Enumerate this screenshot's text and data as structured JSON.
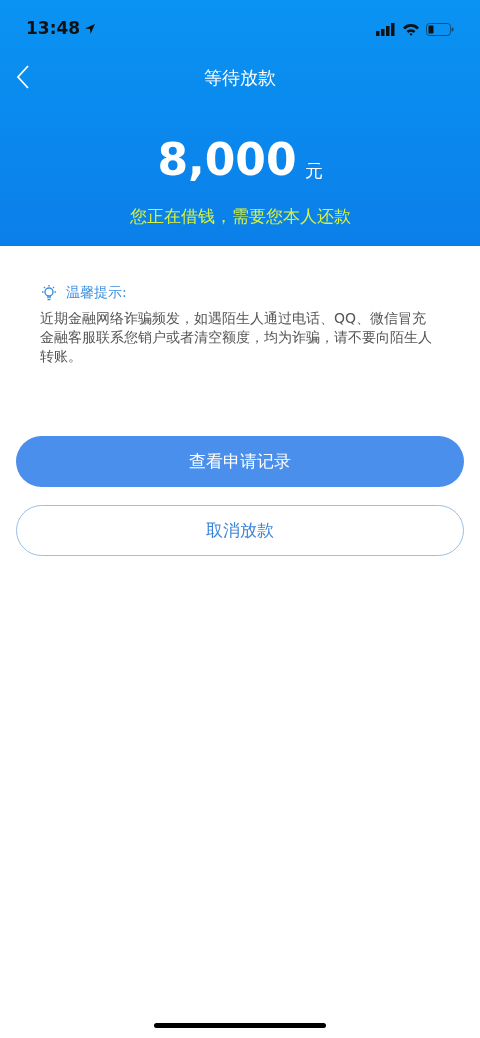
{
  "status_bar": {
    "time": "13:48"
  },
  "nav": {
    "title": "等待放款"
  },
  "amount": {
    "value": "8,000",
    "unit": "元",
    "note": "您正在借钱，需要您本人还款"
  },
  "tip": {
    "title": "温馨提示:",
    "body": "近期金融网络诈骗频发，如遇陌生人通过电话、QQ、微信冒充金融客服联系您销户或者清空额度，均为诈骗，请不要向陌生人转账。"
  },
  "buttons": [
    {
      "label": "查看申请记录",
      "kind": "primary"
    },
    {
      "label": "取消放款",
      "kind": "outline"
    }
  ]
}
